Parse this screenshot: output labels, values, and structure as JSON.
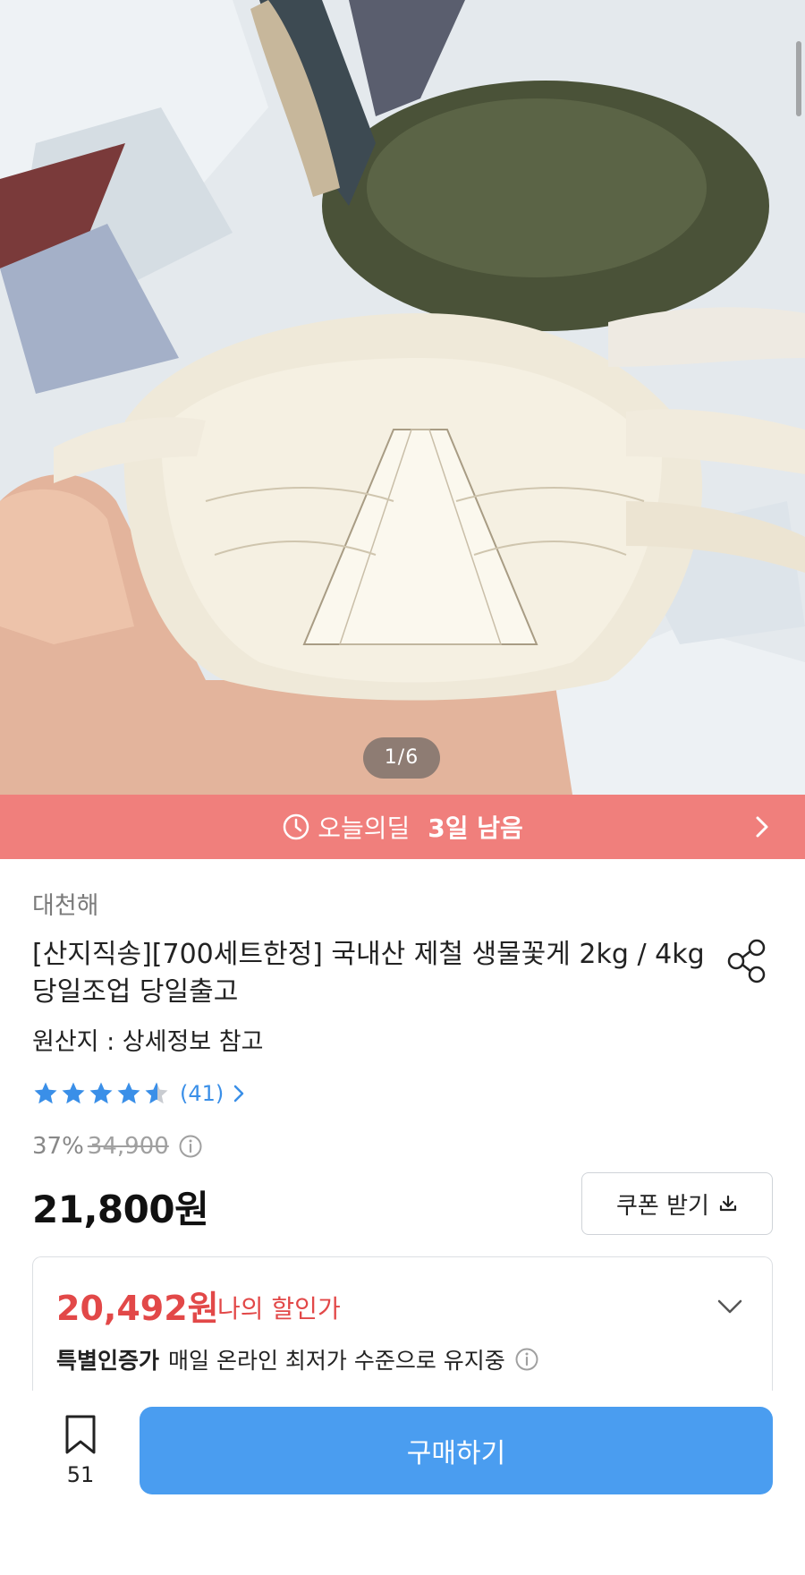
{
  "gallery": {
    "page_indicator": "1/6",
    "image_alt": "blue crab held in hand over ice"
  },
  "deal_banner": {
    "label": "오늘의딜",
    "remaining": "3일 남음",
    "icon": "clock-icon"
  },
  "product": {
    "seller": "대천해",
    "title": "[산지직송][700세트한정] 국내산 제철 생물꽃게 2kg / 4kg 당일조업 당일출고",
    "origin": "원산지 : 상세정보 참고",
    "rating": {
      "stars": 4.5,
      "review_count": "(41)"
    },
    "discount_rate": "37%",
    "original_price": "34,900",
    "price": "21,800원"
  },
  "coupon": {
    "label": "쿠폰 받기"
  },
  "my_discount": {
    "price": "20,492원",
    "label": "나의 할인가",
    "special_bold": "특별인증가",
    "special_text": "매일 온라인 최저가 수준으로 유지중"
  },
  "bottom_bar": {
    "bookmark_count": "51",
    "buy_label": "구매하기"
  },
  "colors": {
    "deal_bg": "#f07f7c",
    "accent_blue": "#4a9df0",
    "sale_red": "#e24848",
    "star_blue": "#3a8fe8"
  }
}
